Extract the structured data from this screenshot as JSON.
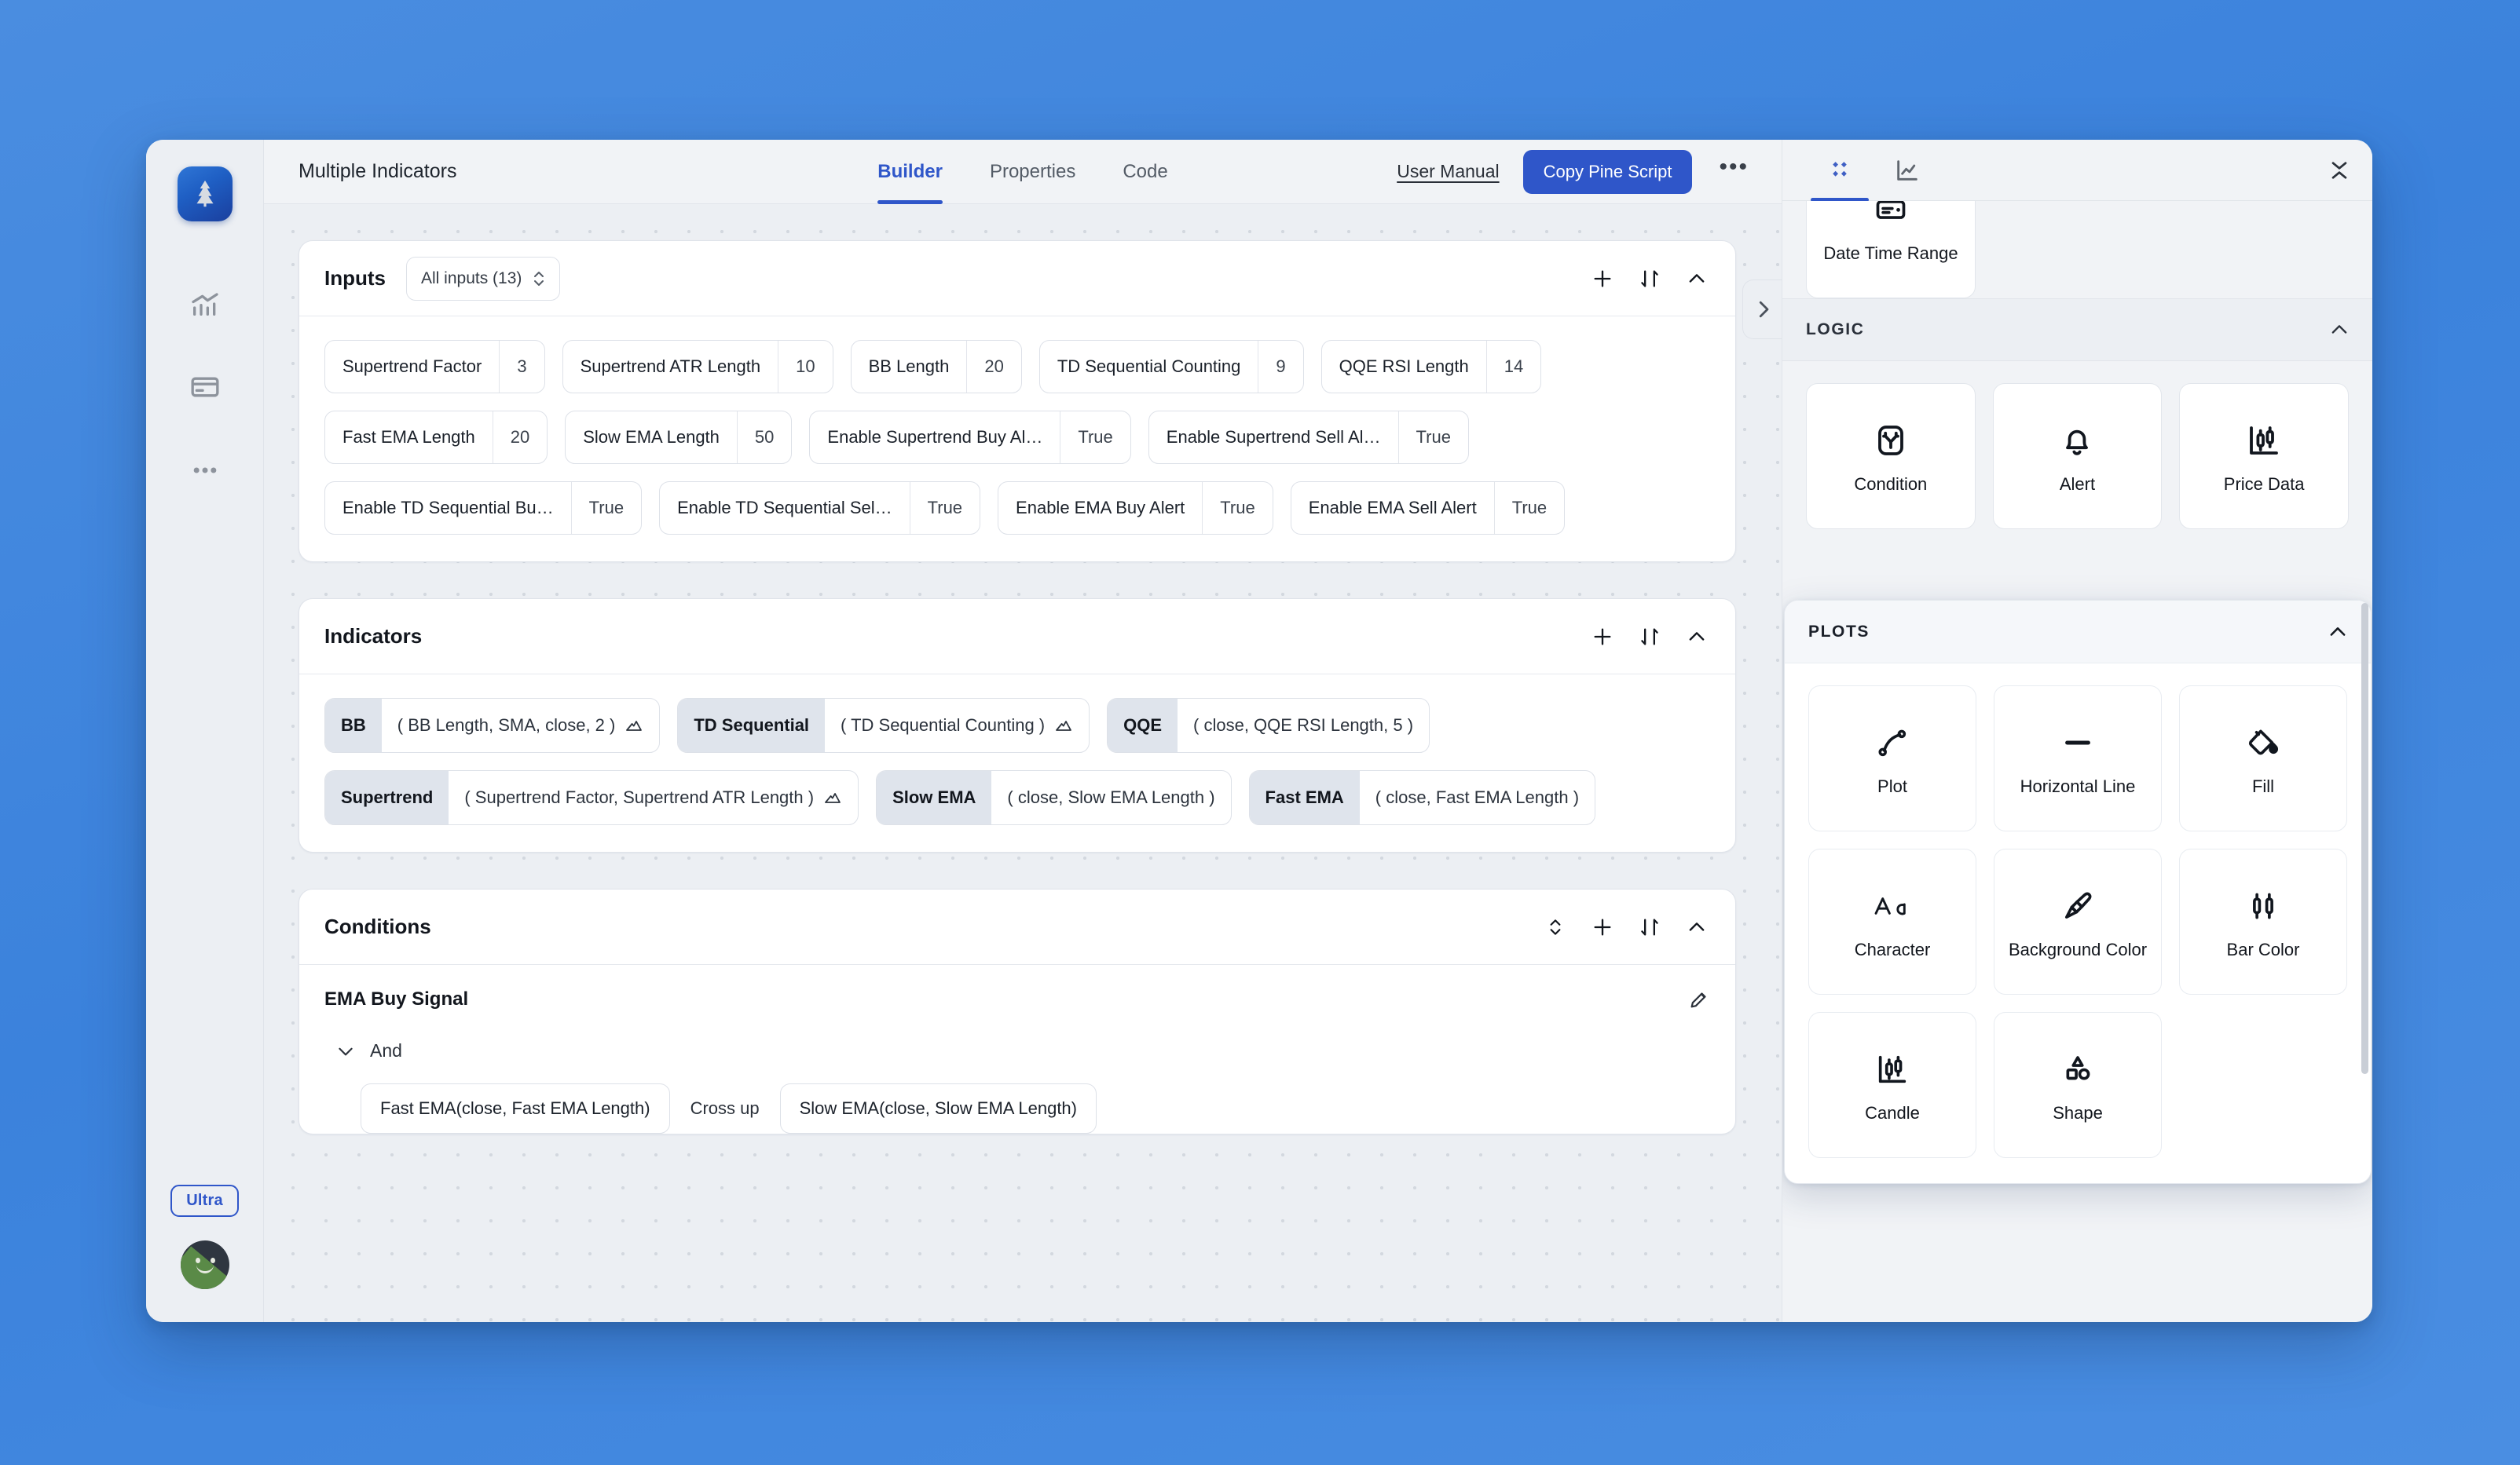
{
  "app": {
    "sidebar": {
      "logo_icon": "pine-tree-logo",
      "items": [
        {
          "icon": "chart-bars-icon",
          "name": "analytics"
        },
        {
          "icon": "credit-card-icon",
          "name": "billing"
        },
        {
          "icon": "ellipsis-icon",
          "name": "more"
        }
      ],
      "plan_badge": "Ultra",
      "avatar_icon": "user-avatar"
    },
    "topbar": {
      "doc_title": "Multiple Indicators",
      "tabs": [
        {
          "label": "Builder",
          "active": true
        },
        {
          "label": "Properties",
          "active": false
        },
        {
          "label": "Code",
          "active": false
        }
      ],
      "user_manual_label": "User Manual",
      "copy_button_label": "Copy Pine Script",
      "more_icon": "ellipsis-icon",
      "accent_color": "#2f56c9"
    },
    "sections": {
      "inputs": {
        "title": "Inputs",
        "filter_label": "All inputs (13)",
        "actions": [
          "add-icon",
          "sort-icon",
          "collapse-icon"
        ],
        "items": [
          {
            "key": "Supertrend Factor",
            "value": "3"
          },
          {
            "key": "Supertrend ATR Length",
            "value": "10"
          },
          {
            "key": "BB Length",
            "value": "20"
          },
          {
            "key": "TD Sequential Counting",
            "value": "9"
          },
          {
            "key": "QQE RSI Length",
            "value": "14"
          },
          {
            "key": "Fast EMA Length",
            "value": "20"
          },
          {
            "key": "Slow EMA Length",
            "value": "50"
          },
          {
            "key": "Enable Supertrend Buy Al…",
            "value": "True"
          },
          {
            "key": "Enable Supertrend Sell Al…",
            "value": "True"
          },
          {
            "key": "Enable TD Sequential Bu…",
            "value": "True"
          },
          {
            "key": "Enable TD Sequential Sel…",
            "value": "True"
          },
          {
            "key": "Enable EMA Buy Alert",
            "value": "True"
          },
          {
            "key": "Enable EMA Sell Alert",
            "value": "True"
          }
        ]
      },
      "indicators": {
        "title": "Indicators",
        "actions": [
          "add-icon",
          "sort-icon",
          "collapse-icon"
        ],
        "items": [
          {
            "name": "BB",
            "args": "( BB Length, SMA, close, 2 )",
            "has_plot_icon": true
          },
          {
            "name": "TD Sequential",
            "args": "( TD Sequential Counting )",
            "has_plot_icon": true
          },
          {
            "name": "QQE",
            "args": "( close, QQE RSI Length, 5 )",
            "has_plot_icon": false
          },
          {
            "name": "Supertrend",
            "args": "( Supertrend Factor, Supertrend ATR Length )",
            "has_plot_icon": true
          },
          {
            "name": "Slow EMA",
            "args": "( close, Slow EMA Length )",
            "has_plot_icon": false
          },
          {
            "name": "Fast EMA",
            "args": "( close, Fast EMA Length )",
            "has_plot_icon": false
          }
        ]
      },
      "conditions": {
        "title": "Conditions",
        "actions": [
          "expand-all-icon",
          "add-icon",
          "sort-icon",
          "collapse-icon"
        ],
        "entries": [
          {
            "name": "EMA Buy Signal",
            "edit_icon": "pencil-icon",
            "group_label": "And",
            "expression": {
              "left": "Fast EMA(close, Fast EMA Length)",
              "operator": "Cross up",
              "right": "Slow EMA(close, Slow EMA Length)"
            }
          }
        ]
      }
    },
    "right_panel": {
      "tabs": [
        {
          "icon": "blocks-diamond-icon",
          "active": true
        },
        {
          "icon": "line-chart-icon",
          "active": false
        }
      ],
      "collapse_icon": "collapse-vertical-icon",
      "handle_icon": "chevron-right-icon",
      "top_partial_tile": {
        "label": "Date Time Range",
        "icon": "date-range-icon"
      },
      "sections": [
        {
          "title": "LOGIC",
          "collapse_icon": "chevron-up-icon",
          "tiles": [
            {
              "label": "Condition",
              "icon": "branch-condition-icon"
            },
            {
              "label": "Alert",
              "icon": "bell-icon"
            },
            {
              "label": "Price Data",
              "icon": "price-data-icon"
            }
          ]
        },
        {
          "title": "PLOTS",
          "collapse_icon": "chevron-up-icon",
          "floating": true,
          "tiles": [
            {
              "label": "Plot",
              "icon": "plot-curve-icon"
            },
            {
              "label": "Horizontal Line",
              "icon": "horizontal-line-icon"
            },
            {
              "label": "Fill",
              "icon": "paint-bucket-icon"
            },
            {
              "label": "Character",
              "icon": "character-aa-icon"
            },
            {
              "label": "Background Color",
              "icon": "paint-brush-icon"
            },
            {
              "label": "Bar Color",
              "icon": "bar-color-icon"
            },
            {
              "label": "Candle",
              "icon": "candle-icon"
            },
            {
              "label": "Shape",
              "icon": "shapes-icon"
            }
          ]
        }
      ]
    }
  }
}
